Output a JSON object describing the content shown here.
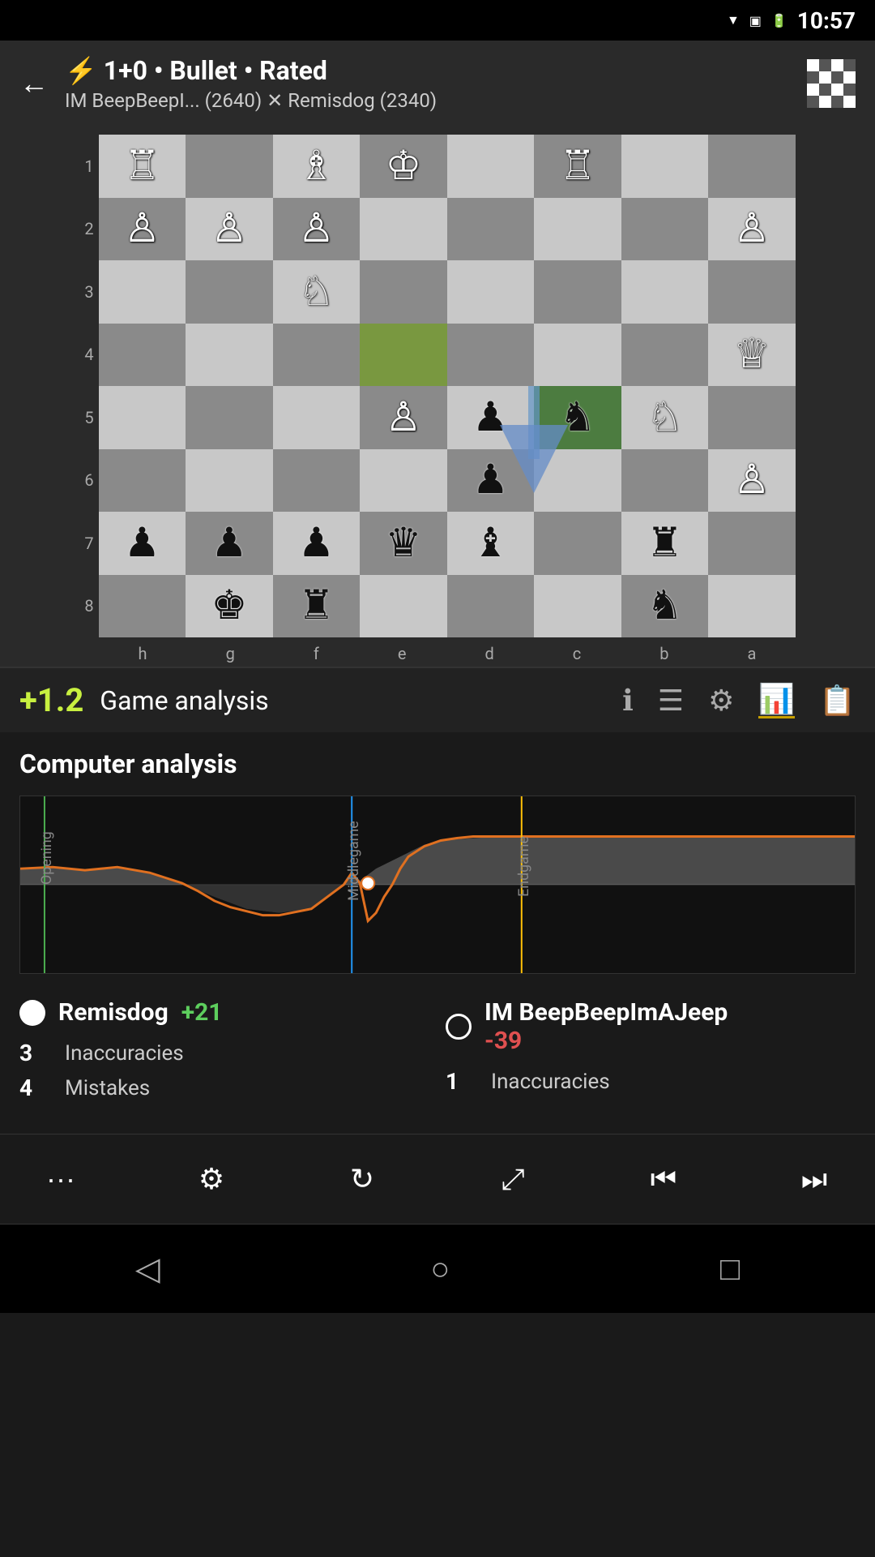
{
  "statusBar": {
    "time": "10:57"
  },
  "header": {
    "backLabel": "←",
    "gameType": "⚡ 1+0 • Bullet • Rated",
    "players": "IM BeepBeepI... (2640) ✕ Remisdog (2340)"
  },
  "analysisBar": {
    "eval": "+1.2",
    "label": "Game analysis",
    "icons": [
      "ℹ",
      "☰",
      "⚙",
      "📊",
      "📋"
    ]
  },
  "computerAnalysis": {
    "title": "Computer analysis"
  },
  "players": [
    {
      "name": "Remisdog",
      "score": "+21",
      "scoreType": "pos",
      "dot": "filled",
      "stats": [
        {
          "num": "3",
          "label": "Inaccuracies"
        },
        {
          "num": "4",
          "label": "Mistakes"
        }
      ]
    },
    {
      "name": "IM BeepBeepImAJeep",
      "score": "-39",
      "scoreType": "neg",
      "dot": "hollow",
      "stats": [
        {
          "num": "1",
          "label": "Inaccuracies"
        }
      ]
    }
  ],
  "toolbar": {
    "buttons": [
      "···",
      "⚙",
      "↻",
      "⤢",
      "⏮",
      "⏭"
    ]
  },
  "navBar": {
    "buttons": [
      "◁",
      "○",
      "□"
    ]
  },
  "board": {
    "rankLabels": [
      "1",
      "2",
      "3",
      "4",
      "5",
      "6",
      "7",
      "8"
    ],
    "fileLabels": [
      "h",
      "g",
      "f",
      "e",
      "d",
      "c",
      "b",
      "a"
    ]
  }
}
